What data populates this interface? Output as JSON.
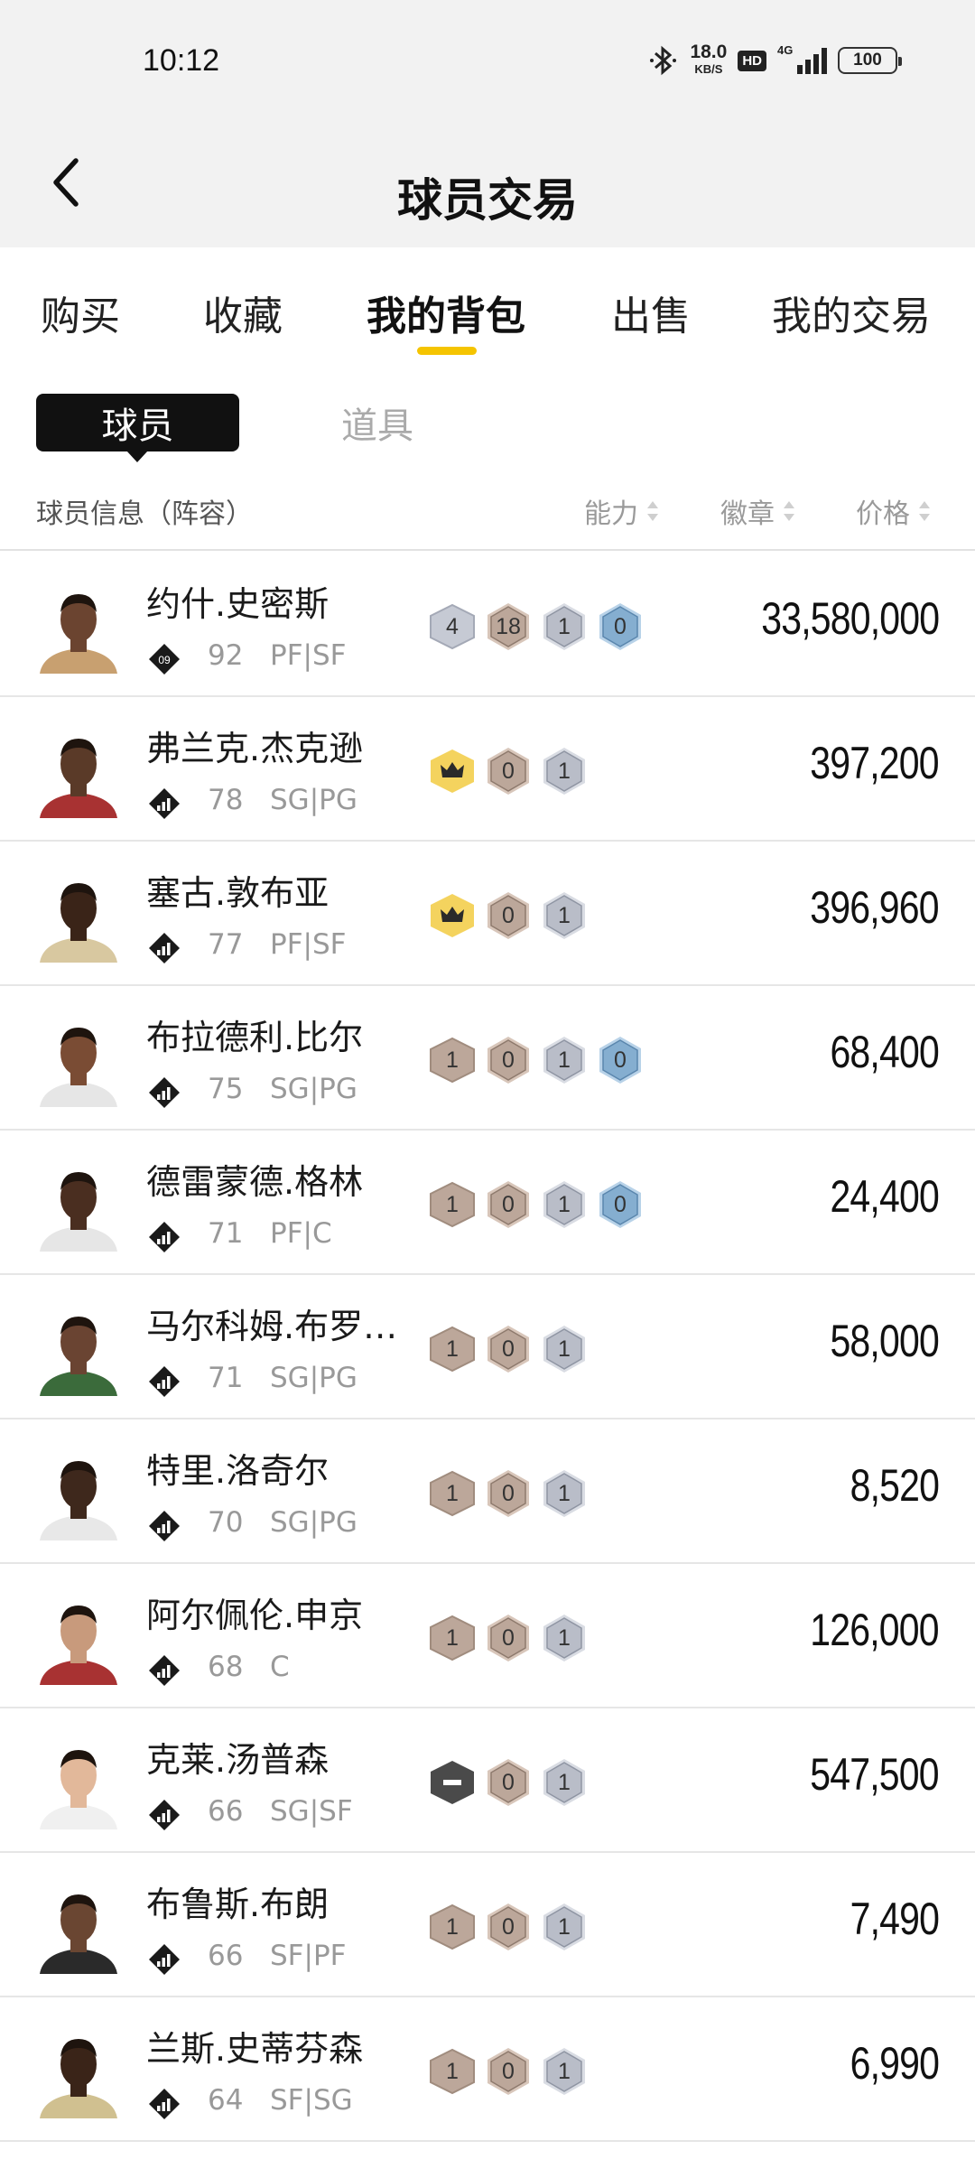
{
  "status_bar": {
    "time": "10:12",
    "net_speed_value": "18.0",
    "net_speed_unit": "KB/S",
    "hd_label": "HD",
    "network_label": "4G",
    "battery": "100"
  },
  "header": {
    "title": "球员交易",
    "back_icon": "chevron-left-icon"
  },
  "tabs": [
    {
      "label": "购买"
    },
    {
      "label": "收藏"
    },
    {
      "label": "我的背包",
      "active": true
    },
    {
      "label": "出售"
    },
    {
      "label": "我的交易"
    }
  ],
  "segments": {
    "players": "球员",
    "items": "道具"
  },
  "columns": {
    "info": "球员信息（阵容）",
    "ability": "能力",
    "badges": "徽章",
    "price": "价格"
  },
  "colors": {
    "accent": "#f5c400",
    "black": "#111111",
    "badge_bronze": "#bca79a",
    "badge_silver": "#b9bdc8",
    "badge_blue": "#85aed0",
    "badge_gold": "#f4d35e"
  },
  "players": [
    {
      "name": "约什.史密斯",
      "rating": "92",
      "pos": "PF|SF",
      "tier_label": "09",
      "price": "33,580,000",
      "badges": [
        {
          "kind": "hex-silver",
          "v": "4"
        },
        {
          "kind": "bronze",
          "v": "18"
        },
        {
          "kind": "silver",
          "v": "1"
        },
        {
          "kind": "blue",
          "v": "0"
        }
      ]
    },
    {
      "name": "弗兰克.杰克逊",
      "rating": "78",
      "pos": "SG|PG",
      "price": "397,200",
      "badges": [
        {
          "kind": "crown",
          "v": ""
        },
        {
          "kind": "bronze",
          "v": "0"
        },
        {
          "kind": "silver",
          "v": "1"
        }
      ]
    },
    {
      "name": "塞古.敦布亚",
      "rating": "77",
      "pos": "PF|SF",
      "price": "396,960",
      "badges": [
        {
          "kind": "crown",
          "v": ""
        },
        {
          "kind": "bronze",
          "v": "0"
        },
        {
          "kind": "silver",
          "v": "1"
        }
      ]
    },
    {
      "name": "布拉德利.比尔",
      "rating": "75",
      "pos": "SG|PG",
      "price": "68,400",
      "badges": [
        {
          "kind": "hex-bronze",
          "v": "1"
        },
        {
          "kind": "bronze",
          "v": "0"
        },
        {
          "kind": "silver",
          "v": "1"
        },
        {
          "kind": "blue",
          "v": "0"
        }
      ]
    },
    {
      "name": "德雷蒙德.格林",
      "rating": "71",
      "pos": "PF|C",
      "price": "24,400",
      "badges": [
        {
          "kind": "hex-bronze",
          "v": "1"
        },
        {
          "kind": "bronze",
          "v": "0"
        },
        {
          "kind": "silver",
          "v": "1"
        },
        {
          "kind": "blue",
          "v": "0"
        }
      ]
    },
    {
      "name": "马尔科姆.布罗格...",
      "rating": "71",
      "pos": "SG|PG",
      "price": "58,000",
      "badges": [
        {
          "kind": "hex-bronze",
          "v": "1"
        },
        {
          "kind": "bronze",
          "v": "0"
        },
        {
          "kind": "silver",
          "v": "1"
        }
      ]
    },
    {
      "name": "特里.洛奇尔",
      "rating": "70",
      "pos": "SG|PG",
      "price": "8,520",
      "badges": [
        {
          "kind": "hex-bronze",
          "v": "1"
        },
        {
          "kind": "bronze",
          "v": "0"
        },
        {
          "kind": "silver",
          "v": "1"
        }
      ]
    },
    {
      "name": "阿尔佩伦.申京",
      "rating": "68",
      "pos": "C",
      "price": "126,000",
      "badges": [
        {
          "kind": "hex-bronze",
          "v": "1"
        },
        {
          "kind": "bronze",
          "v": "0"
        },
        {
          "kind": "silver",
          "v": "1"
        }
      ]
    },
    {
      "name": "克莱.汤普森",
      "rating": "66",
      "pos": "SG|SF",
      "price": "547,500",
      "badges": [
        {
          "kind": "dash",
          "v": ""
        },
        {
          "kind": "bronze",
          "v": "0"
        },
        {
          "kind": "silver",
          "v": "1"
        }
      ]
    },
    {
      "name": "布鲁斯.布朗",
      "rating": "66",
      "pos": "SF|PF",
      "price": "7,490",
      "badges": [
        {
          "kind": "hex-bronze",
          "v": "1"
        },
        {
          "kind": "bronze",
          "v": "0"
        },
        {
          "kind": "silver",
          "v": "1"
        }
      ]
    },
    {
      "name": "兰斯.史蒂芬森",
      "rating": "64",
      "pos": "SF|SG",
      "price": "6,990",
      "badges": [
        {
          "kind": "hex-bronze",
          "v": "1"
        },
        {
          "kind": "bronze",
          "v": "0"
        },
        {
          "kind": "silver",
          "v": "1"
        }
      ]
    }
  ]
}
